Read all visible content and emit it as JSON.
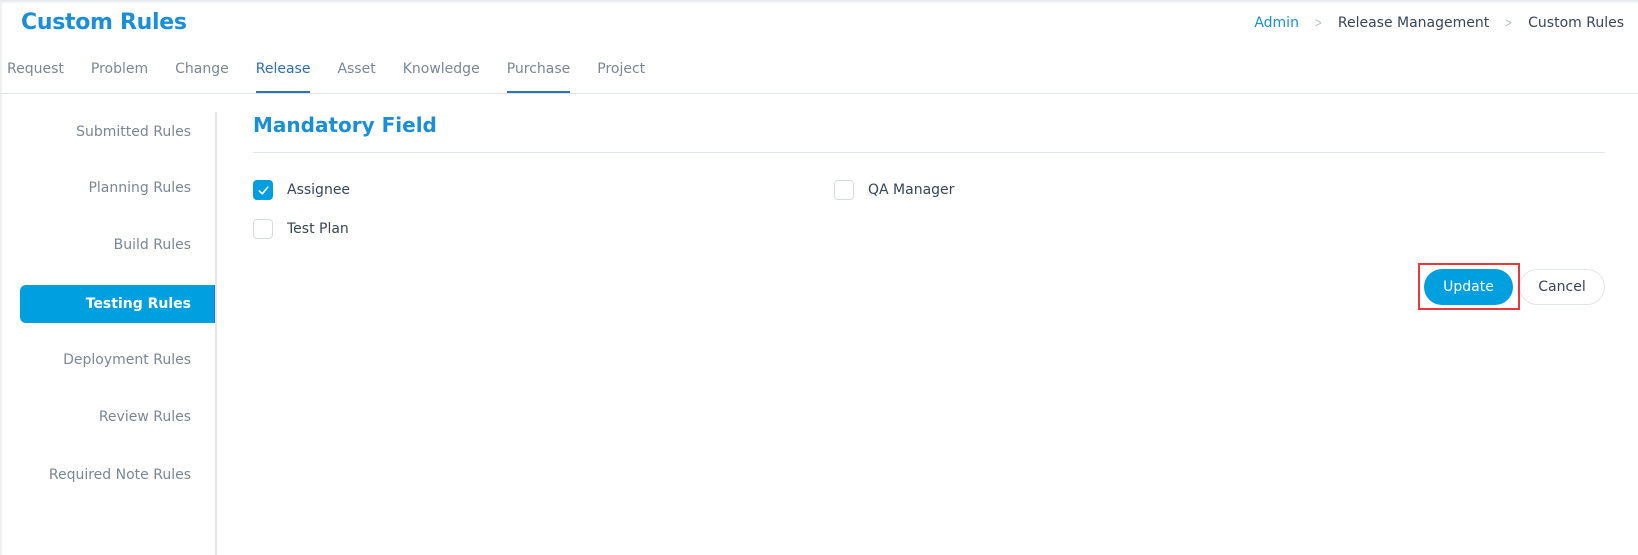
{
  "header": {
    "title": "Custom Rules",
    "breadcrumb": [
      "Admin",
      "Release Management",
      "Custom Rules"
    ],
    "breadcrumb_separator": ">"
  },
  "tabs": [
    {
      "label": "Request",
      "active": false,
      "underlined": false
    },
    {
      "label": "Problem",
      "active": false,
      "underlined": false
    },
    {
      "label": "Change",
      "active": false,
      "underlined": false
    },
    {
      "label": "Release",
      "active": true,
      "underlined": true
    },
    {
      "label": "Asset",
      "active": false,
      "underlined": false
    },
    {
      "label": "Knowledge",
      "active": false,
      "underlined": false
    },
    {
      "label": "Purchase",
      "active": false,
      "underlined": true
    },
    {
      "label": "Project",
      "active": false,
      "underlined": false
    }
  ],
  "sidebar": {
    "items": [
      {
        "label": "Submitted Rules",
        "active": false
      },
      {
        "label": "Planning Rules",
        "active": false
      },
      {
        "label": "Build Rules",
        "active": false
      },
      {
        "label": "Testing Rules",
        "active": true
      },
      {
        "label": "Deployment Rules",
        "active": false
      },
      {
        "label": "Review Rules",
        "active": false
      },
      {
        "label": "Required Note Rules",
        "active": false
      }
    ]
  },
  "main": {
    "section_title": "Mandatory Field",
    "fields": [
      {
        "label": "Assignee",
        "checked": true
      },
      {
        "label": "QA Manager",
        "checked": false
      },
      {
        "label": "Test Plan",
        "checked": false
      }
    ],
    "buttons": {
      "update_label": "Update",
      "cancel_label": "Cancel"
    }
  },
  "colors": {
    "accent": "#009fdf",
    "title": "#1a8fd6",
    "tab_active": "#2f72b8",
    "highlight": "#e8383d"
  }
}
